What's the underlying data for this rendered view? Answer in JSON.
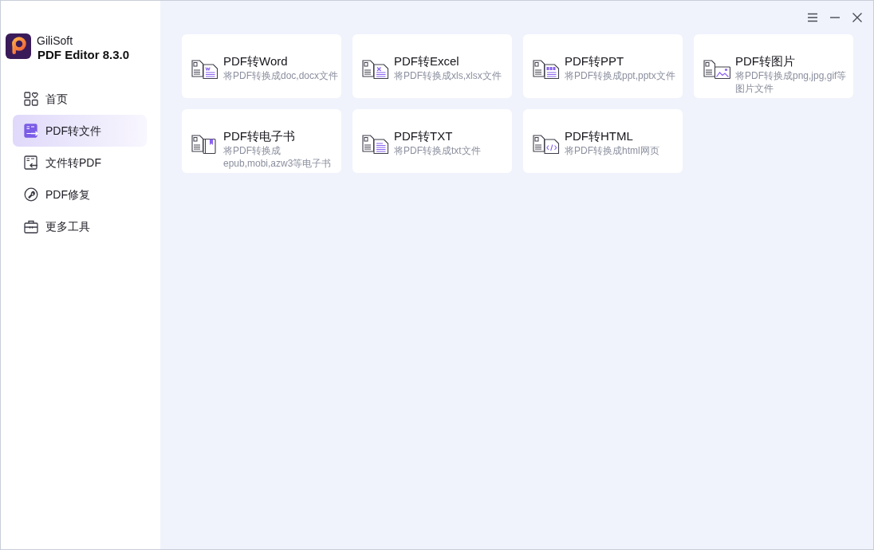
{
  "app": {
    "vendor": "GiliSoft",
    "product": "PDF Editor 8.3.0"
  },
  "sidebar": {
    "items": [
      {
        "label": "首页",
        "selected": false
      },
      {
        "label": "PDF转文件",
        "selected": true
      },
      {
        "label": "文件转PDF",
        "selected": false
      },
      {
        "label": "PDF修复",
        "selected": false
      },
      {
        "label": "更多工具",
        "selected": false
      }
    ]
  },
  "tools": [
    {
      "title": "PDF转Word",
      "description": "将PDF转换成doc,docx文件"
    },
    {
      "title": "PDF转Excel",
      "description": "将PDF转换成xls,xlsx文件"
    },
    {
      "title": "PDF转PPT",
      "description": "将PDF转换成ppt,pptx文件"
    },
    {
      "title": "PDF转图片",
      "description": "将PDF转换成png,jpg,gif等图片文件"
    },
    {
      "title": "PDF转电子书",
      "description": "将PDF转换成epub,mobi,azw3等电子书"
    },
    {
      "title": "PDF转TXT",
      "description": "将PDF转换成txt文件"
    },
    {
      "title": "PDF转HTML",
      "description": "将PDF转换成html网页"
    }
  ]
}
